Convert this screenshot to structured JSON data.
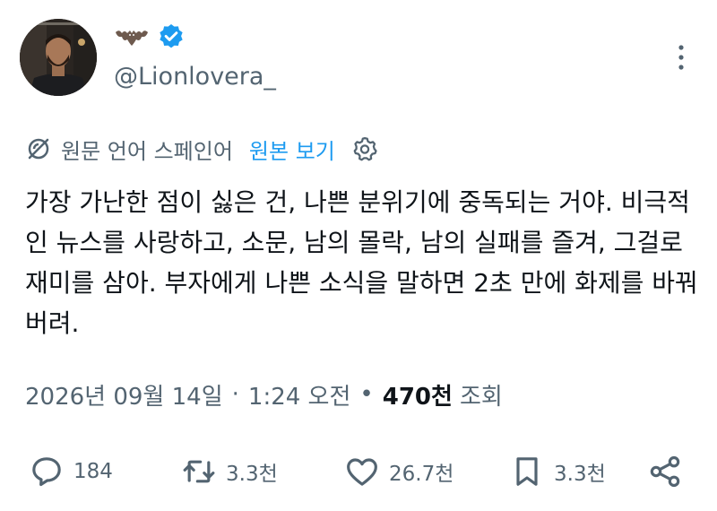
{
  "author": {
    "name_emoji": "bat-emoji",
    "verified_icon": "verified-badge-icon",
    "handle": "@Lionlovera_"
  },
  "translation": {
    "source_language_label": "원문 언어 스페인어",
    "show_original_label": "원본 보기",
    "icon": "translate-icon",
    "settings_icon": "settings-gear-icon"
  },
  "tweet": {
    "text": "가장 가난한 점이 싫은 건, 나쁜 분위기에 중독되는 거야. 비극적인 뉴스를 사랑하고, 소문, 남의 몰락, 남의 실패를 즐겨, 그걸로 재미를 삼아. 부자에게 나쁜 소식을 말하면 2초 만에 화제를 바꿔버려."
  },
  "meta": {
    "date": "2026년 09월 14일",
    "separator": "·",
    "time": "1:24 오전",
    "bullet": "•",
    "views_count": "470천",
    "views_label": "조회"
  },
  "actions": {
    "reply_count": "184",
    "repost_count": "3.3천",
    "like_count": "26.7천",
    "bookmark_count": "3.3천"
  },
  "colors": {
    "text": "#0f1419",
    "secondary": "#536471",
    "accent": "#1d9bf0"
  }
}
